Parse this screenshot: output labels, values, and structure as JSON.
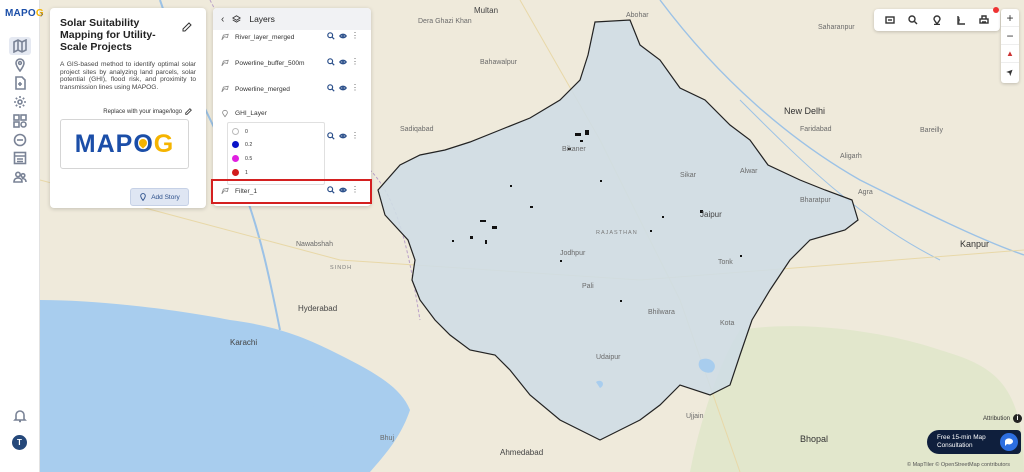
{
  "app": {
    "logo_text": "MAPOG",
    "logo_main": "MAP",
    "logo_o": "O",
    "logo_g": "G",
    "avatar_initial": "T"
  },
  "rail": {
    "items": [
      "map-icon",
      "pin-icon",
      "file-add-icon",
      "settings-icon",
      "layers-analysis-icon",
      "data-icon",
      "table-icon",
      "team-icon"
    ]
  },
  "story": {
    "title": "Solar Suitability Mapping for Utility-Scale Projects",
    "description": "A GIS-based method to identify optimal solar project sites by analyzing land parcels, solar potential (GHI), flood risk, and proximity to transmission lines using MAPOG.",
    "replace_label": "Replace with your image/logo",
    "add_story_label": "Add Story"
  },
  "layers": {
    "title": "Layers",
    "items": [
      {
        "name": "River_layer_merged"
      },
      {
        "name": "Powerline_buffer_500m"
      },
      {
        "name": "Powerline_merged"
      },
      {
        "name": "GHI_Layer"
      },
      {
        "name": "Filter_1"
      }
    ],
    "legend": [
      {
        "label": "0",
        "color": "#ffffff"
      },
      {
        "label": "0.2",
        "color": "#0b14c8"
      },
      {
        "label": "0.5",
        "color": "#e020e0"
      },
      {
        "label": "1",
        "color": "#d21c1c"
      }
    ]
  },
  "toolbar": {
    "icons": [
      "map-print-icon",
      "search-icon",
      "location-icon",
      "measure-icon",
      "print-icon"
    ]
  },
  "zoom": {
    "in": "+",
    "out": "−",
    "compass": "▲",
    "locate": "➤"
  },
  "map": {
    "labels": {
      "multan": "Multan",
      "abohar": "Abohar",
      "saharanpur": "Saharanpur",
      "dera_ghazi_khan": "Dera Ghazi Khan",
      "bahawalpur": "Bahawalpur",
      "new_delhi": "New Delhi",
      "faridabad": "Faridabad",
      "sadiqabad": "Sadiqabad",
      "bikaner": "Bikaner",
      "aligarh": "Aligarh",
      "jaipur": "Jaipur",
      "bharatpur": "Bharatpur",
      "rajasthan": "RAJASTHAN",
      "sindh": "SINDH",
      "nawabshah": "Nawabshah",
      "jodhpur": "Jodhpur",
      "hyderabad": "Hyderabad",
      "kanpur": "Kanpur",
      "tonk": "Tonk",
      "pali": "Pali",
      "bhilwara": "Bhilwara",
      "kota": "Kota",
      "karachi": "Karachi",
      "udaipur": "Udaipur",
      "ujjain": "Ujjain",
      "bhuj": "Bhuj",
      "bhopal": "Bhopal",
      "ahmedabad": "Ahmedabad",
      "agra": "Agra",
      "alwar": "Alwar",
      "bareilly": "Bareilly",
      "sikar": "Sikar"
    }
  },
  "attribution": {
    "label": "Attribution",
    "info": "i"
  },
  "consult": {
    "text": "Free 15-min Map Consultation"
  },
  "credits": "© MapTiler © OpenStreetMap contributors"
}
